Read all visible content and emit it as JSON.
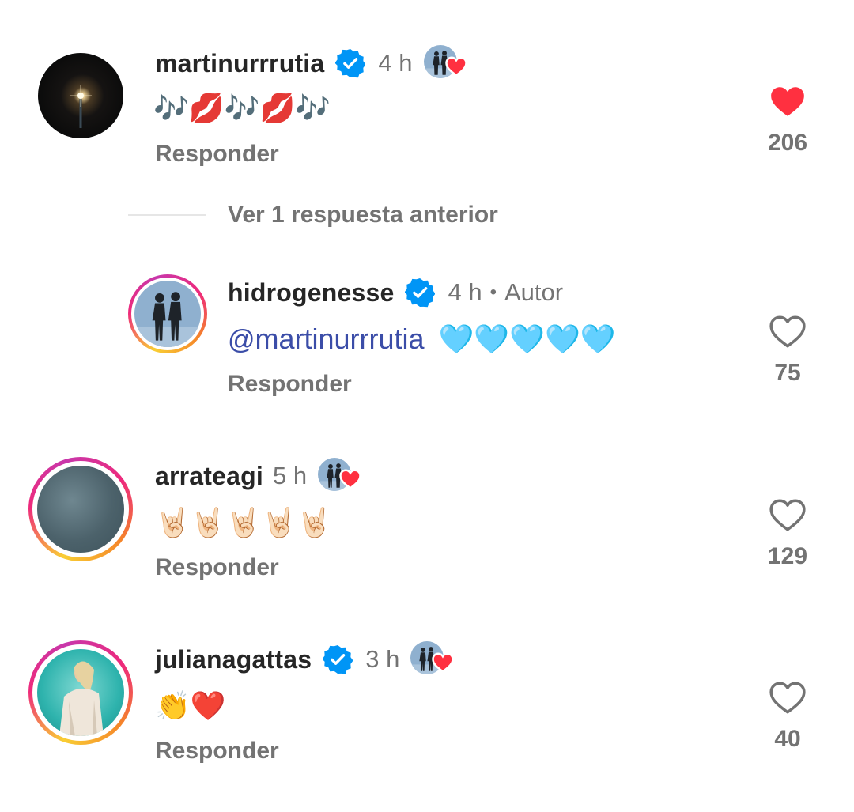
{
  "comments": [
    {
      "username": "martinurrrutia",
      "verified": true,
      "time": "4 h",
      "text": "🎶💋🎶💋🎶",
      "reply_label": "Responder",
      "likes": "206",
      "liked": true
    },
    {
      "username": "hidrogenesse",
      "verified": true,
      "time": "4 h",
      "separator": "•",
      "author_label": "Autor",
      "mention_symbol": "@",
      "mention": "martinurrrutia",
      "text": "🩵🩵🩵🩵🩵",
      "reply_label": "Responder",
      "likes": "75",
      "liked": false
    },
    {
      "username": "arrateagi",
      "verified": false,
      "time": "5 h",
      "text": "🤘🏻🤘🏻🤘🏻🤘🏻🤘🏻",
      "reply_label": "Responder",
      "likes": "129",
      "liked": false
    },
    {
      "username": "julianagattas",
      "verified": true,
      "time": "3 h",
      "text": "👏❤️",
      "reply_label": "Responder",
      "likes": "40",
      "liked": false
    }
  ],
  "thread": {
    "view_previous": "Ver 1 respuesta anterior"
  },
  "colors": {
    "heart_red": "#ff3040",
    "verified_blue": "#0095f6",
    "mention_blue": "#3b4da8",
    "muted": "#737373"
  }
}
